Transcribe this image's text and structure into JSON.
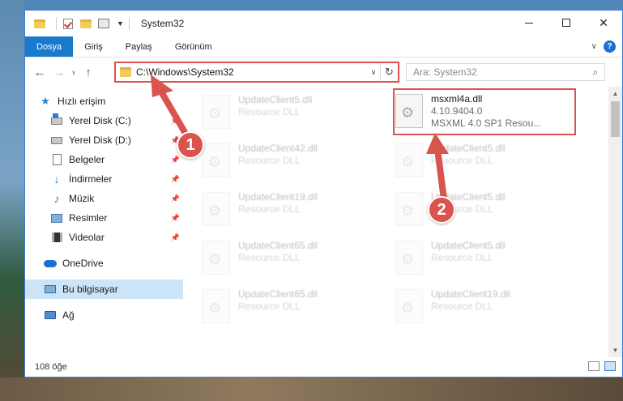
{
  "window": {
    "title": "System32"
  },
  "ribbon": {
    "tabs": [
      "Dosya",
      "Giriş",
      "Paylaş",
      "Görünüm"
    ],
    "help": "?"
  },
  "address": {
    "path": "C:\\Windows\\System32",
    "search_placeholder": "Ara: System32"
  },
  "sidebar": {
    "items": [
      {
        "label": "Hızlı erişim",
        "icon": "star-icon"
      },
      {
        "label": "Yerel Disk (C:)",
        "icon": "drive-icon"
      },
      {
        "label": "Yerel Disk (D:)",
        "icon": "drive-icon"
      },
      {
        "label": "Belgeler",
        "icon": "documents-icon"
      },
      {
        "label": "İndirmeler",
        "icon": "downloads-icon"
      },
      {
        "label": "Müzik",
        "icon": "music-icon"
      },
      {
        "label": "Resimler",
        "icon": "pictures-icon"
      },
      {
        "label": "Videolar",
        "icon": "videos-icon"
      },
      {
        "label": "OneDrive",
        "icon": "onedrive-icon"
      },
      {
        "label": "Bu bilgisayar",
        "icon": "this-pc-icon"
      },
      {
        "label": "Ağ",
        "icon": "network-icon"
      }
    ]
  },
  "files": {
    "selected": {
      "name": "msxml4a.dll",
      "version": "4.10.9404.0",
      "description": "MSXML 4.0 SP1 Resou..."
    },
    "left_column": [
      {
        "name": "UpdateClient5.dll",
        "type": "Resource DLL"
      },
      {
        "name": "UpdateClient42.dll",
        "type": "Resource DLL"
      },
      {
        "name": "UpdateClient19.dll",
        "type": "Resource DLL"
      },
      {
        "name": "UpdateClient65.dll",
        "type": "Resource DLL"
      },
      {
        "name": "UpdateClient65.dll",
        "type": "Resource DLL"
      }
    ],
    "right_column": [
      {
        "name": "UpdateClient5.dll",
        "type": "Resource DLL"
      },
      {
        "name": "UpdateClient5.dll",
        "type": "Resource DLL"
      },
      {
        "name": "UpdateClient5.dll",
        "type": "Resource DLL"
      },
      {
        "name": "UpdateClient19.dll",
        "type": "Resource DLL"
      }
    ]
  },
  "status": {
    "item_count": "108 öğe"
  },
  "annotations": {
    "step1": "1",
    "step2": "2",
    "color": "#d9534f"
  }
}
